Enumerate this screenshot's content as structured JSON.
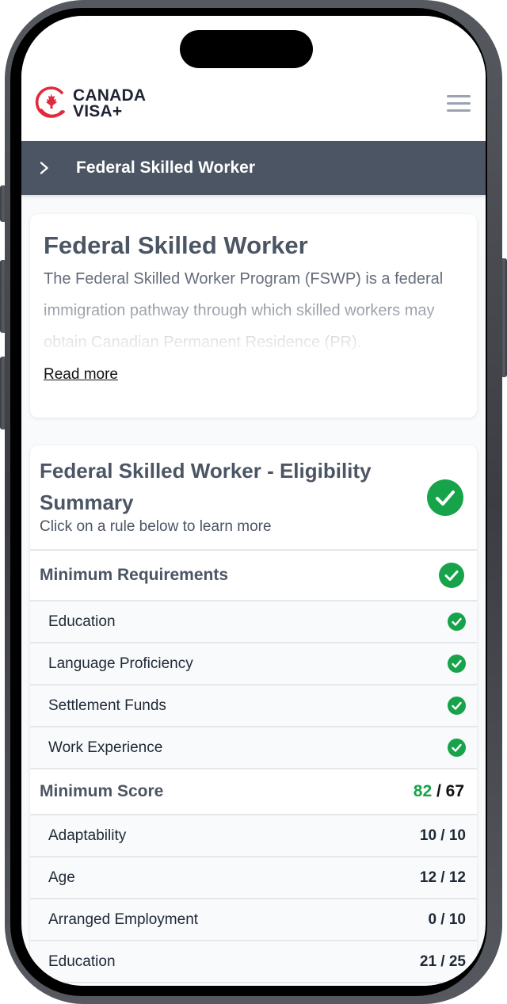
{
  "app": {
    "logo": {
      "line1": "CANADA",
      "line2": "VISA",
      "plus": "+"
    },
    "menu_icon": "hamburger-menu-icon"
  },
  "breadcrumb": {
    "icon": "chevron-right-icon",
    "title": "Federal Skilled Worker"
  },
  "intro": {
    "title": "Federal Skilled Worker",
    "description": "The Federal Skilled Worker Program (FSWP) is a federal immigration pathway through which skilled workers may obtain Canadian Permanent Residence (PR).",
    "read_more": "Read more"
  },
  "summary": {
    "title": "Federal Skilled Worker - Eligibility Summary",
    "subtitle": "Click on a rule below to learn more",
    "status": "eligible",
    "status_icon": "check-circle-icon",
    "accent": "#16a34a",
    "minimum_requirements": {
      "label": "Minimum Requirements",
      "status": "passed",
      "items": [
        {
          "label": "Education",
          "status": "passed"
        },
        {
          "label": "Language Proficiency",
          "status": "passed"
        },
        {
          "label": "Settlement Funds",
          "status": "passed"
        },
        {
          "label": "Work Experience",
          "status": "passed"
        }
      ]
    },
    "minimum_score": {
      "label": "Minimum Score",
      "score": "82",
      "separator": " / ",
      "required": "67",
      "items": [
        {
          "label": "Adaptability",
          "value": "10 / 10"
        },
        {
          "label": "Age",
          "value": "12 / 12"
        },
        {
          "label": "Arranged Employment",
          "value": "0 / 10"
        },
        {
          "label": "Education",
          "value": "21 / 25"
        }
      ]
    }
  }
}
